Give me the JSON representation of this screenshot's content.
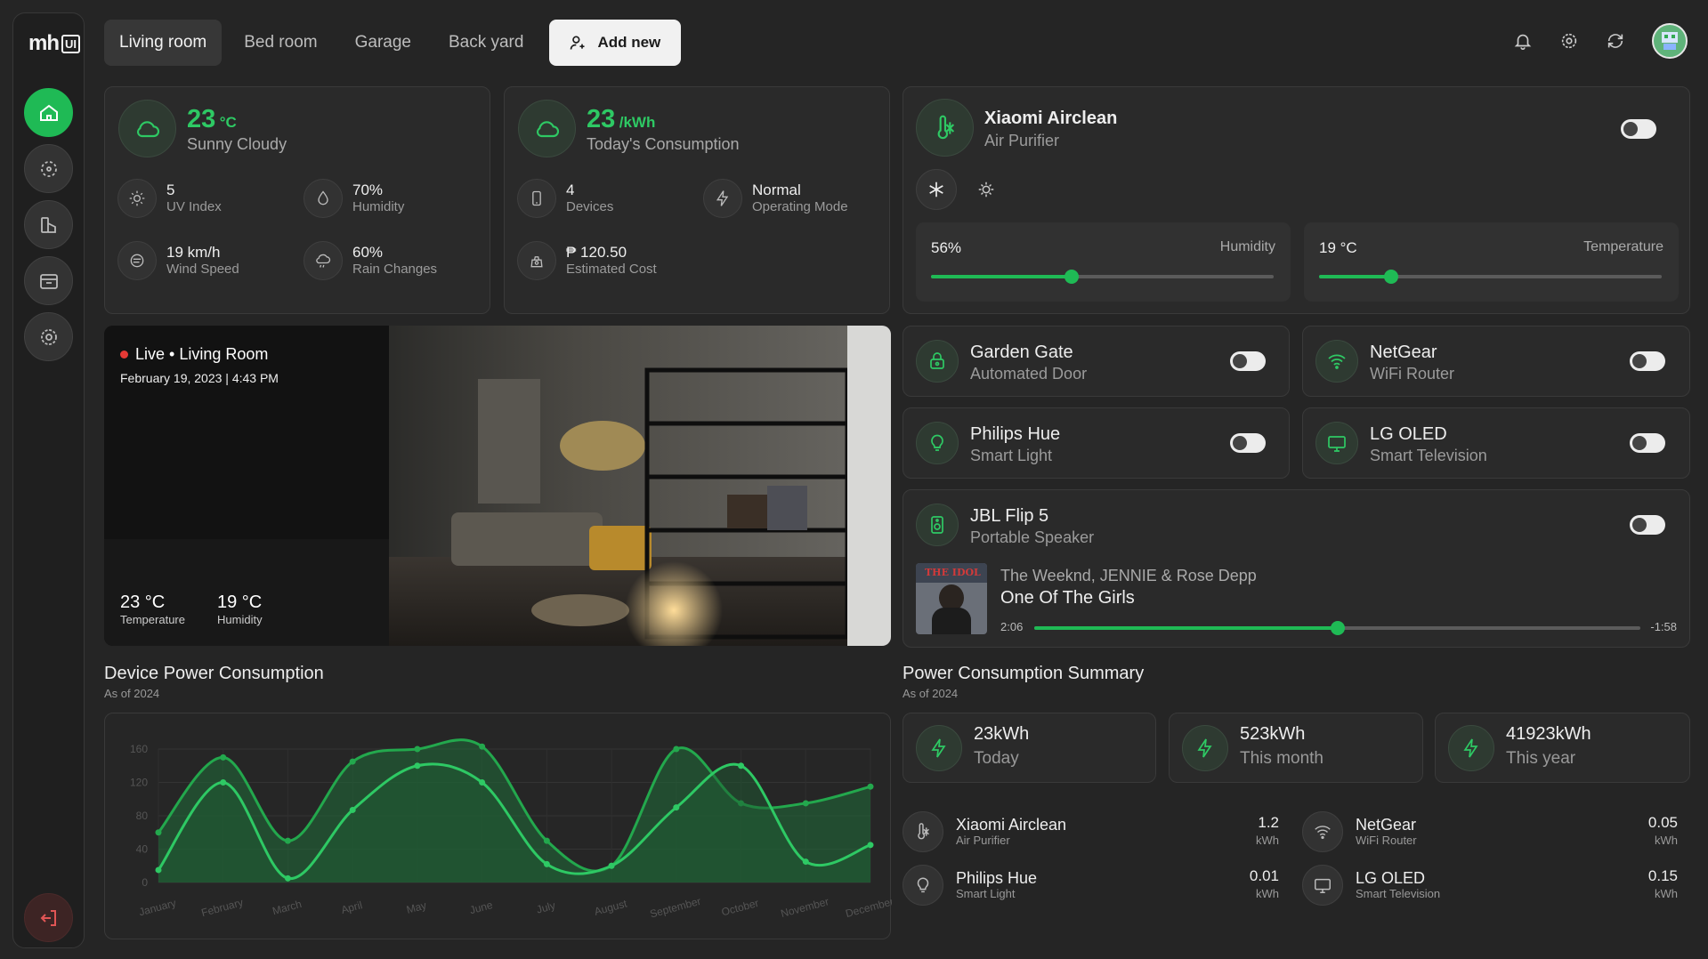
{
  "logo": {
    "left": "mh",
    "right": "UI"
  },
  "tabs": [
    "Living room",
    "Bed room",
    "Garage",
    "Back yard"
  ],
  "add_new": "Add new",
  "weather": {
    "temp": "23",
    "unit": "°C",
    "desc": "Sunny Cloudy",
    "stats": [
      {
        "value": "5",
        "label": "UV Index"
      },
      {
        "value": "70%",
        "label": "Humidity"
      },
      {
        "value": "19 km/h",
        "label": "Wind Speed"
      },
      {
        "value": "60%",
        "label": "Rain Changes"
      }
    ]
  },
  "consumption": {
    "value": "23",
    "unit": "/kWh",
    "desc": "Today's Consumption",
    "stats": [
      {
        "value": "4",
        "label": "Devices"
      },
      {
        "value": "Normal",
        "label": "Operating Mode"
      },
      {
        "value": "₱ 120.50",
        "label": "Estimated Cost"
      }
    ]
  },
  "purifier": {
    "name": "Xiaomi Airclean",
    "type": "Air Purifier",
    "humidity_value": "56%",
    "humidity_label": "Humidity",
    "humidity_level": 0.41,
    "temp_value": "19 °C",
    "temp_label": "Temperature",
    "temp_level": 0.21
  },
  "devices": [
    {
      "name": "Garden Gate",
      "type": "Automated Door",
      "icon": "lock-icon"
    },
    {
      "name": "NetGear",
      "type": "WiFi Router",
      "icon": "wifi-icon"
    },
    {
      "name": "Philips Hue",
      "type": "Smart Light",
      "icon": "bulb-icon"
    },
    {
      "name": "LG OLED",
      "type": "Smart Television",
      "icon": "monitor-icon"
    }
  ],
  "speaker": {
    "name": "JBL Flip 5",
    "type": "Portable Speaker",
    "artist": "The Weeknd, JENNIE & Rose Depp",
    "song": "One Of The Girls",
    "elapsed": "2:06",
    "remaining": "-1:58",
    "progress": 0.5,
    "album_text": "THE IDOL"
  },
  "camera": {
    "live": "Live • Living Room",
    "date": "February 19, 2023 | 4:43 PM",
    "temp": "23 °C",
    "temp_label": "Temperature",
    "hum": "19 °C",
    "hum_label": "Humidity"
  },
  "chart_section": {
    "title": "Device Power Consumption",
    "subtitle": "As of 2024"
  },
  "chart_data": {
    "type": "area",
    "categories": [
      "January",
      "February",
      "March",
      "April",
      "May",
      "June",
      "July",
      "August",
      "September",
      "October",
      "November",
      "December"
    ],
    "yticks": [
      "160",
      "120",
      "80",
      "40",
      "0"
    ],
    "ylim": [
      0,
      160
    ],
    "series": [
      {
        "values": [
          60,
          150,
          50,
          145,
          160,
          163,
          50,
          20,
          160,
          95,
          95,
          115
        ]
      },
      {
        "values": [
          15,
          120,
          5,
          87,
          140,
          120,
          22,
          20,
          90,
          140,
          25,
          45
        ]
      }
    ]
  },
  "summary": {
    "title": "Power Consumption Summary",
    "subtitle": "As of 2024",
    "cards": [
      {
        "value": "23kWh",
        "label": "Today"
      },
      {
        "value": "523kWh",
        "label": "This month"
      },
      {
        "value": "41923kWh",
        "label": "This year"
      }
    ],
    "rows": [
      {
        "name": "Xiaomi Airclean",
        "type": "Air Purifier",
        "value": "1.2",
        "unit": "kWh",
        "icon": "thermo-fan-icon"
      },
      {
        "name": "NetGear",
        "type": "WiFi Router",
        "value": "0.05",
        "unit": "kWh",
        "icon": "wifi-icon"
      },
      {
        "name": "Philips Hue",
        "type": "Smart Light",
        "value": "0.01",
        "unit": "kWh",
        "icon": "bulb-icon"
      },
      {
        "name": "LG OLED",
        "type": "Smart Television",
        "value": "0.15",
        "unit": "kWh",
        "icon": "monitor-icon"
      }
    ]
  },
  "colors": {
    "accent": "#2ec964",
    "background": "#252525",
    "card": "#2a2a2a"
  }
}
